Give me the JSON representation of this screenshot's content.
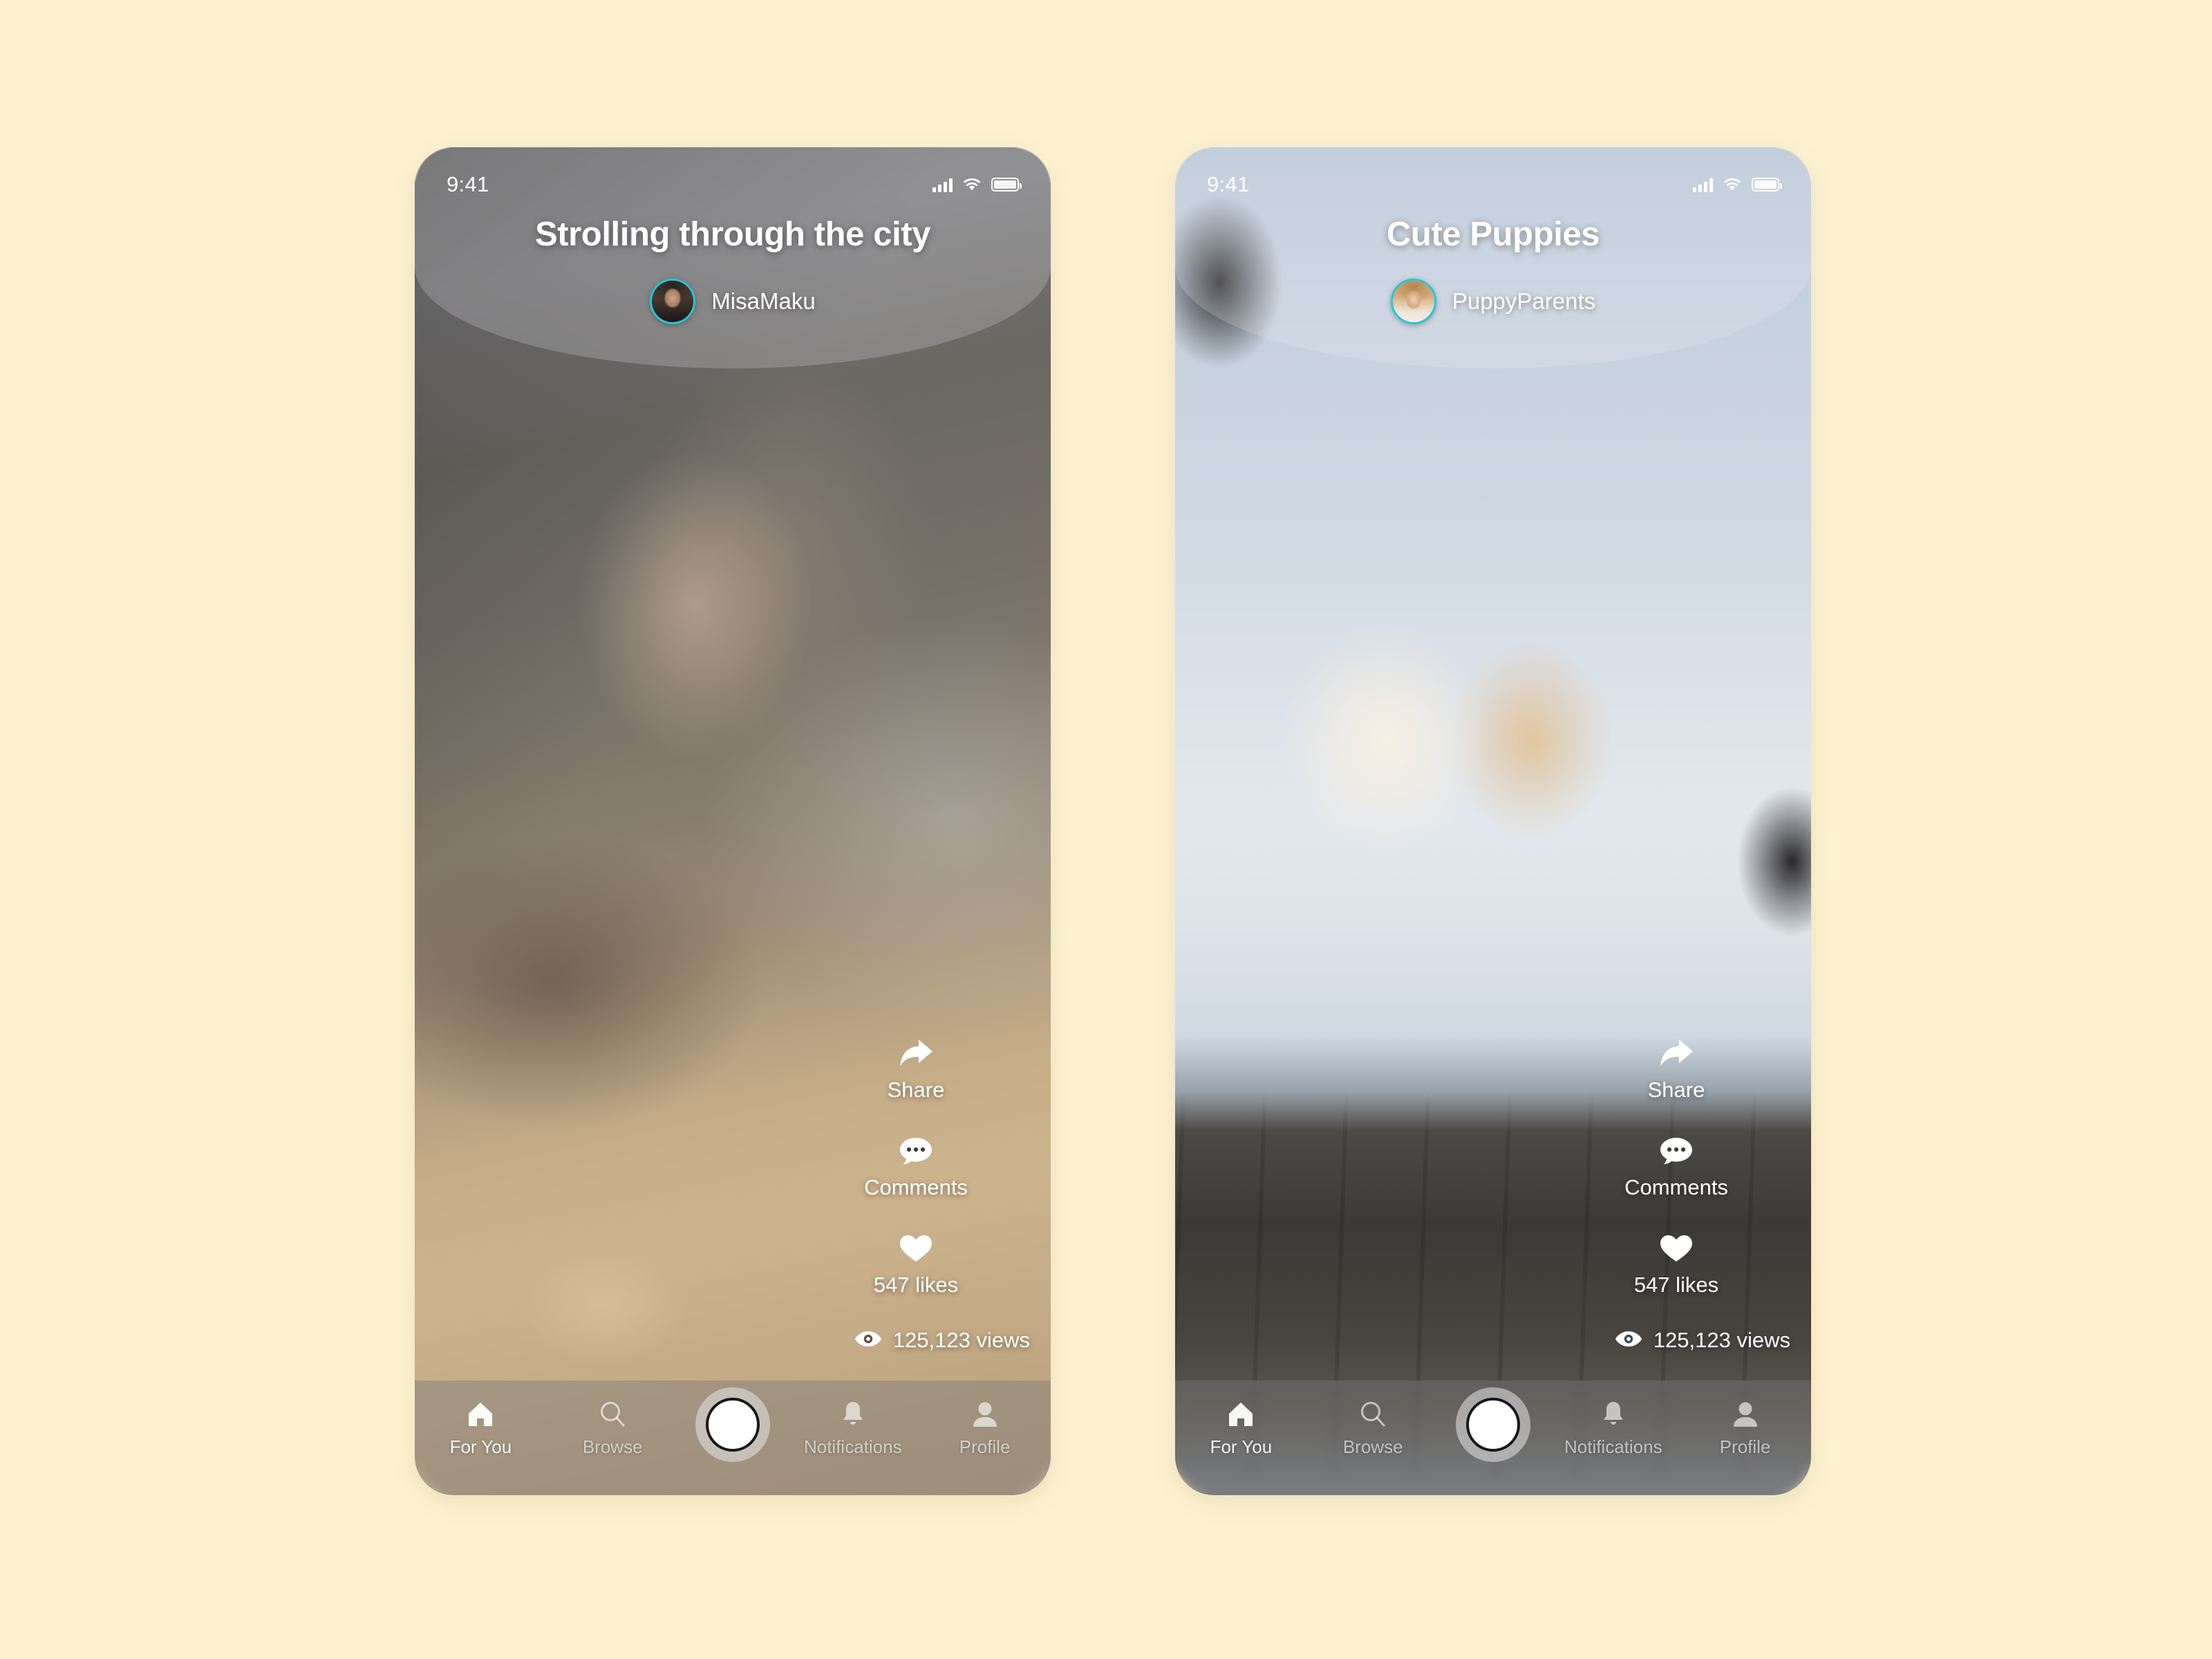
{
  "canvas": {
    "background_color": "#FDF2D0",
    "accent_color": "#1EC8DC"
  },
  "phones": [
    {
      "id": "left",
      "status_bar": {
        "time": "9:41",
        "cellular_icon": "cellular-bars-icon",
        "wifi_icon": "wifi-icon",
        "battery_icon": "battery-icon"
      },
      "post": {
        "title": "Strolling through the city",
        "author": "MisaMaku",
        "avatar_icon": "avatar-misamaku"
      },
      "actions": {
        "share": {
          "label": "Share",
          "icon": "share-arrow-icon"
        },
        "comments": {
          "label": "Comments",
          "icon": "comment-bubble-icon"
        },
        "likes": {
          "label": "547 likes",
          "icon": "heart-icon"
        },
        "views": {
          "label": "125,123 views",
          "icon": "eye-icon"
        }
      },
      "nav": {
        "items": [
          {
            "label": "For You",
            "icon": "home-icon",
            "active": true
          },
          {
            "label": "Browse",
            "icon": "search-icon",
            "active": false
          },
          {
            "label": "Notifications",
            "icon": "bell-icon",
            "active": false
          },
          {
            "label": "Profile",
            "icon": "person-icon",
            "active": false
          }
        ],
        "record_button": "record-button"
      }
    },
    {
      "id": "right",
      "status_bar": {
        "time": "9:41",
        "cellular_icon": "cellular-bars-icon",
        "wifi_icon": "wifi-icon",
        "battery_icon": "battery-icon"
      },
      "post": {
        "title": "Cute Puppies",
        "author": "PuppyParents",
        "avatar_icon": "avatar-puppyparents"
      },
      "actions": {
        "share": {
          "label": "Share",
          "icon": "share-arrow-icon"
        },
        "comments": {
          "label": "Comments",
          "icon": "comment-bubble-icon"
        },
        "likes": {
          "label": "547 likes",
          "icon": "heart-icon"
        },
        "views": {
          "label": "125,123 views",
          "icon": "eye-icon"
        }
      },
      "nav": {
        "items": [
          {
            "label": "For You",
            "icon": "home-icon",
            "active": true
          },
          {
            "label": "Browse",
            "icon": "search-icon",
            "active": false
          },
          {
            "label": "Notifications",
            "icon": "bell-icon",
            "active": false
          },
          {
            "label": "Profile",
            "icon": "person-icon",
            "active": false
          }
        ],
        "record_button": "record-button"
      }
    }
  ]
}
